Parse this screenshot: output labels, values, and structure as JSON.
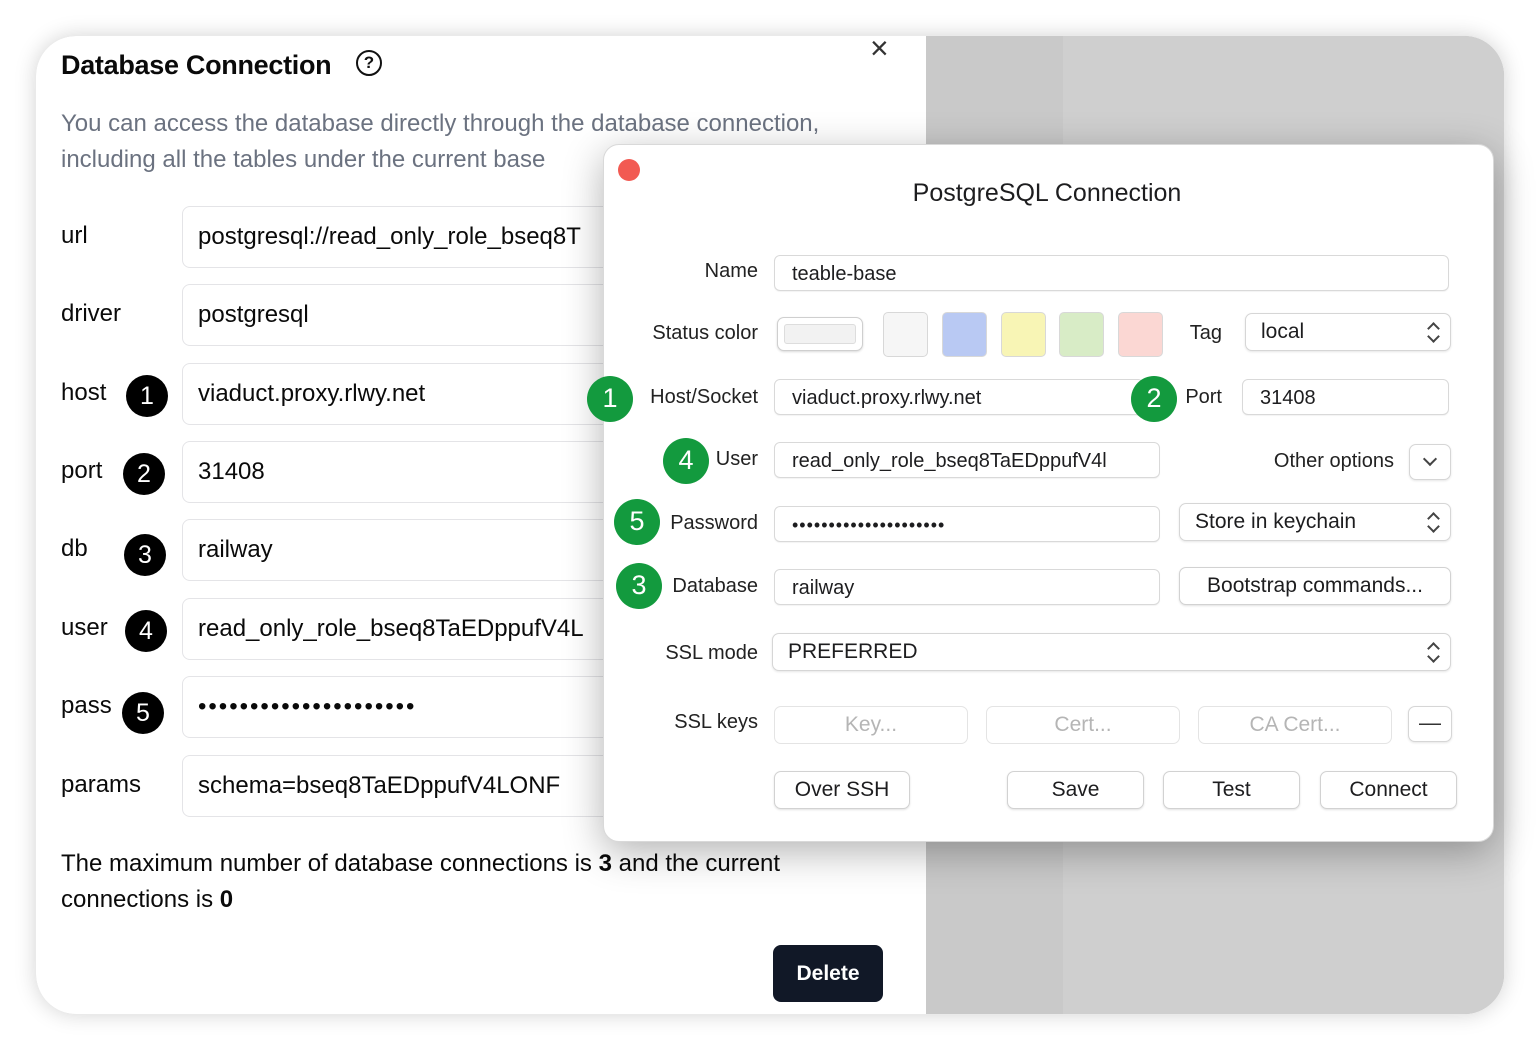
{
  "panel": {
    "title": "Database Connection",
    "description": "You can access the database directly through the database connection, including all the tables under the current base",
    "rows": [
      {
        "label": "url",
        "value": "postgresql://read_only_role_bseq8T",
        "badge": ""
      },
      {
        "label": "driver",
        "value": "postgresql",
        "badge": ""
      },
      {
        "label": "host",
        "value": "viaduct.proxy.rlwy.net",
        "badge": "1"
      },
      {
        "label": "port",
        "value": "31408",
        "badge": "2"
      },
      {
        "label": "db",
        "value": "railway",
        "badge": "3"
      },
      {
        "label": "user",
        "value": "read_only_role_bseq8TaEDppufV4L",
        "badge": "4"
      },
      {
        "label": "pass",
        "value": "•••••••••••••••••••••",
        "badge": "5"
      },
      {
        "label": "params",
        "value": "schema=bseq8TaEDppufV4LONF",
        "badge": ""
      }
    ],
    "footer_prefix": "The maximum number of database connections is ",
    "max_connections": "3",
    "footer_middle": " and the current connections is ",
    "current_connections": "0",
    "delete_label": "Delete"
  },
  "dialog": {
    "title": "PostgreSQL Connection",
    "name_label": "Name",
    "name_value": "teable-base",
    "status_color_label": "Status color",
    "status_colors": [
      "#f6f6f6",
      "#b9c9f3",
      "#f8f5b5",
      "#d8ecc6",
      "#fbd7d3"
    ],
    "tag_label": "Tag",
    "tag_value": "local",
    "host_label": "Host/Socket",
    "host_value": "viaduct.proxy.rlwy.net",
    "port_label": "Port",
    "port_value": "31408",
    "user_label": "User",
    "user_value": "read_only_role_bseq8TaEDppufV4l",
    "other_options_label": "Other options",
    "password_label": "Password",
    "password_value": "•••••••••••••••••••••",
    "store_value": "Store in keychain",
    "database_label": "Database",
    "database_value": "railway",
    "bootstrap_label": "Bootstrap commands...",
    "ssl_mode_label": "SSL mode",
    "ssl_mode_value": "PREFERRED",
    "ssl_keys_label": "SSL keys",
    "key_label": "Key...",
    "cert_label": "Cert...",
    "ca_cert_label": "CA Cert...",
    "minus_label": "—",
    "over_ssh_label": "Over SSH",
    "save_label": "Save",
    "test_label": "Test",
    "connect_label": "Connect",
    "badges": {
      "host": "1",
      "port": "2",
      "user": "4",
      "password": "5",
      "database": "3"
    }
  }
}
